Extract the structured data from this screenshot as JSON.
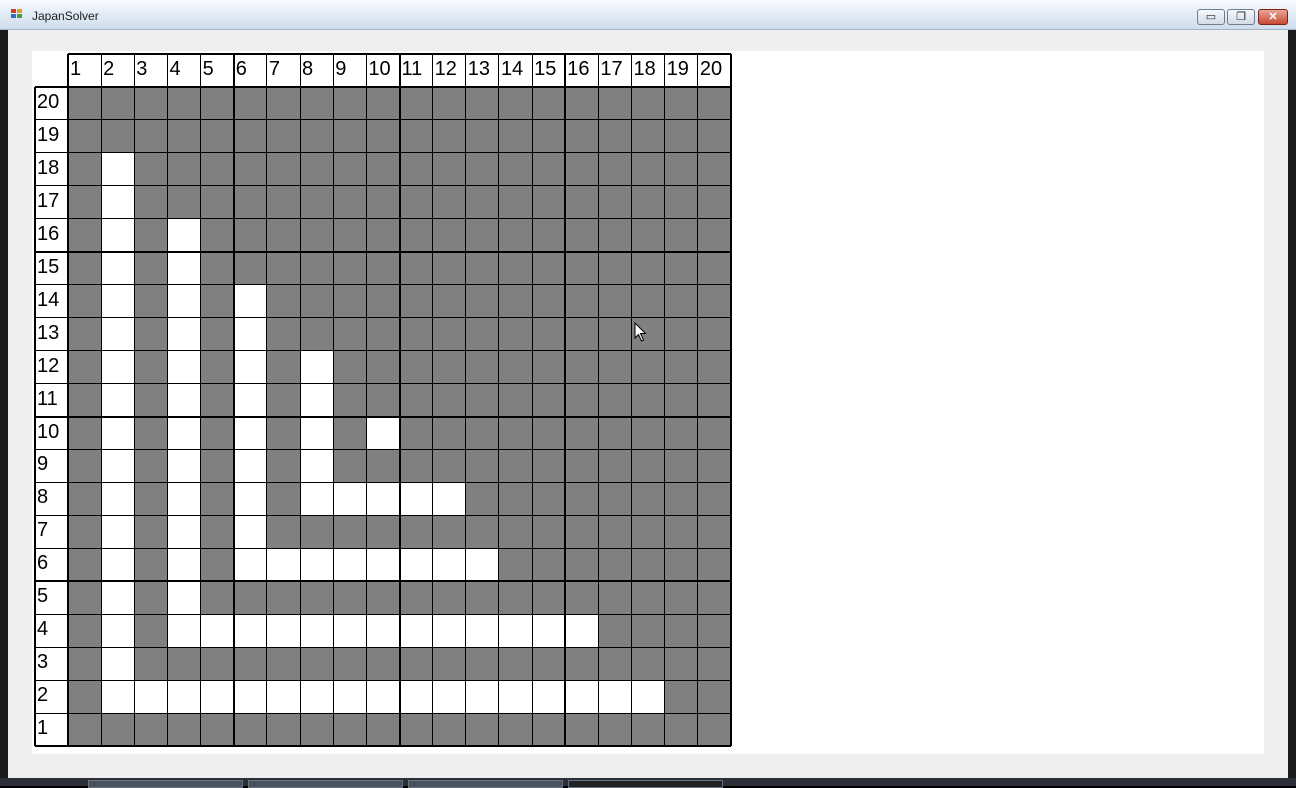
{
  "window": {
    "title": "JapanSolver",
    "min_glyph": "▭",
    "max_glyph": "❐",
    "close_glyph": "✕"
  },
  "grid": {
    "col_labels": [
      "1",
      "2",
      "3",
      "4",
      "5",
      "6",
      "7",
      "8",
      "9",
      "10",
      "11",
      "12",
      "13",
      "14",
      "15",
      "16",
      "17",
      "18",
      "19",
      "20"
    ],
    "row_labels": [
      "20",
      "19",
      "18",
      "17",
      "16",
      "15",
      "14",
      "13",
      "12",
      "11",
      "10",
      "9",
      "8",
      "7",
      "6",
      "5",
      "4",
      "3",
      "2",
      "1"
    ],
    "rows": [
      "11111111111111111111",
      "11111111111111111111",
      "10111111111111111111",
      "10111111111111111111",
      "10101111111111111111",
      "10101111111111111111",
      "10101011111111111111",
      "10101011111111111111",
      "10101010111111111111",
      "10101010111111111111",
      "10101010101111111111",
      "10101010111111111111",
      "10101010000011111111",
      "10101011111111111111",
      "10101000000001111111",
      "10101111111111111111",
      "10100000000000001111",
      "10111111111111111111",
      "10000000000000000011",
      "11111111111111111111"
    ],
    "colors": {
      "filled": "#808080",
      "blank": "#ffffff",
      "line": "#000000"
    }
  }
}
